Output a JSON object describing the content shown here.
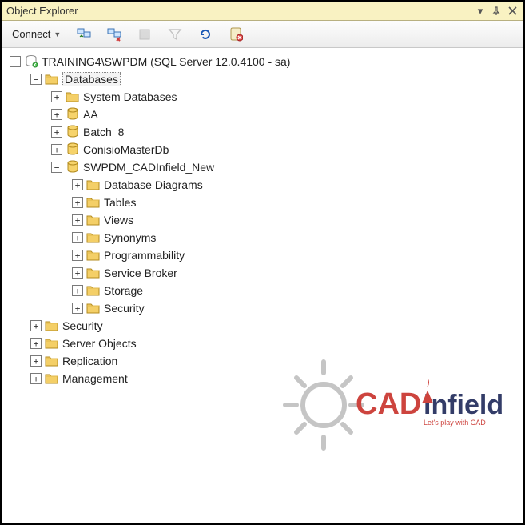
{
  "titlebar": {
    "title": "Object Explorer"
  },
  "toolbar": {
    "connect_label": "Connect"
  },
  "tree": {
    "server": {
      "label": "TRAINING4\\SWPDM (SQL Server 12.0.4100 - sa)"
    },
    "databases": {
      "label": "Databases"
    },
    "system_databases": {
      "label": "System Databases"
    },
    "db_aa": {
      "label": "AA"
    },
    "db_batch8": {
      "label": "Batch_8"
    },
    "db_conisio": {
      "label": "ConisioMasterDb"
    },
    "db_swpdm": {
      "label": "SWPDM_CADInfield_New"
    },
    "swpdm_folders": {
      "diagrams": "Database Diagrams",
      "tables": "Tables",
      "views": "Views",
      "synonyms": "Synonyms",
      "programmability": "Programmability",
      "service_broker": "Service Broker",
      "storage": "Storage",
      "security": "Security"
    },
    "srv_security": {
      "label": "Security"
    },
    "srv_objects": {
      "label": "Server Objects"
    },
    "srv_replication": {
      "label": "Replication"
    },
    "srv_management": {
      "label": "Management"
    }
  },
  "watermark": {
    "text_cad": "CAD",
    "text_infield": "infield",
    "tagline": "Let's play with CAD"
  }
}
